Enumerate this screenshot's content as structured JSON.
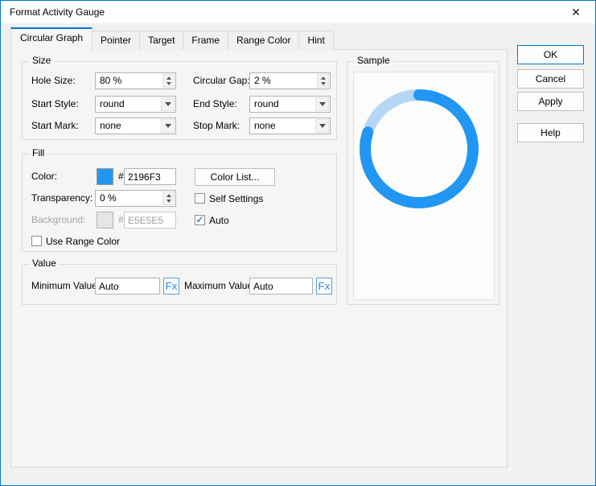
{
  "window": {
    "title": "Format Activity Gauge"
  },
  "icons": {
    "close": "✕",
    "check": "✓"
  },
  "colors": {
    "accent": "#0078D7",
    "fill": "#2196F3",
    "fill_light": "#B3D7F5"
  },
  "tabs": [
    {
      "label": "Circular Graph",
      "active": true
    },
    {
      "label": "Pointer",
      "active": false
    },
    {
      "label": "Target",
      "active": false
    },
    {
      "label": "Frame",
      "active": false
    },
    {
      "label": "Range Color",
      "active": false
    },
    {
      "label": "Hint",
      "active": false
    }
  ],
  "size": {
    "legend": "Size",
    "hole_size_label": "Hole Size:",
    "hole_size_value": "80 %",
    "circular_gap_label": "Circular Gap:",
    "circular_gap_value": "2 %",
    "start_style_label": "Start Style:",
    "start_style_value": "round",
    "end_style_label": "End Style:",
    "end_style_value": "round",
    "start_mark_label": "Start Mark:",
    "start_mark_value": "none",
    "stop_mark_label": "Stop Mark:",
    "stop_mark_value": "none"
  },
  "fill": {
    "legend": "Fill",
    "color_label": "Color:",
    "hash": "#",
    "color_value": "2196F3",
    "color_hex": "#2196F3",
    "color_list_button": "Color List...",
    "transparency_label": "Transparency:",
    "transparency_value": "0 %",
    "self_settings_label": "Self Settings",
    "background_label": "Background:",
    "background_value": "E5E5E5",
    "background_hex": "#E5E5E5",
    "auto_label": "Auto",
    "use_range_color_label": "Use Range Color"
  },
  "value": {
    "legend": "Value",
    "min_label": "Minimum Value:",
    "min_value": "Auto",
    "max_label": "Maximum Value:",
    "max_value": "Auto",
    "fx_label": "Fx"
  },
  "sample": {
    "legend": "Sample",
    "gauge": {
      "percent": 80,
      "gap_degrees": 7,
      "value_color": "#2196F3",
      "remainder_color": "#B3D7F5"
    }
  },
  "action_buttons": {
    "ok": "OK",
    "cancel": "Cancel",
    "apply": "Apply",
    "help": "Help"
  }
}
